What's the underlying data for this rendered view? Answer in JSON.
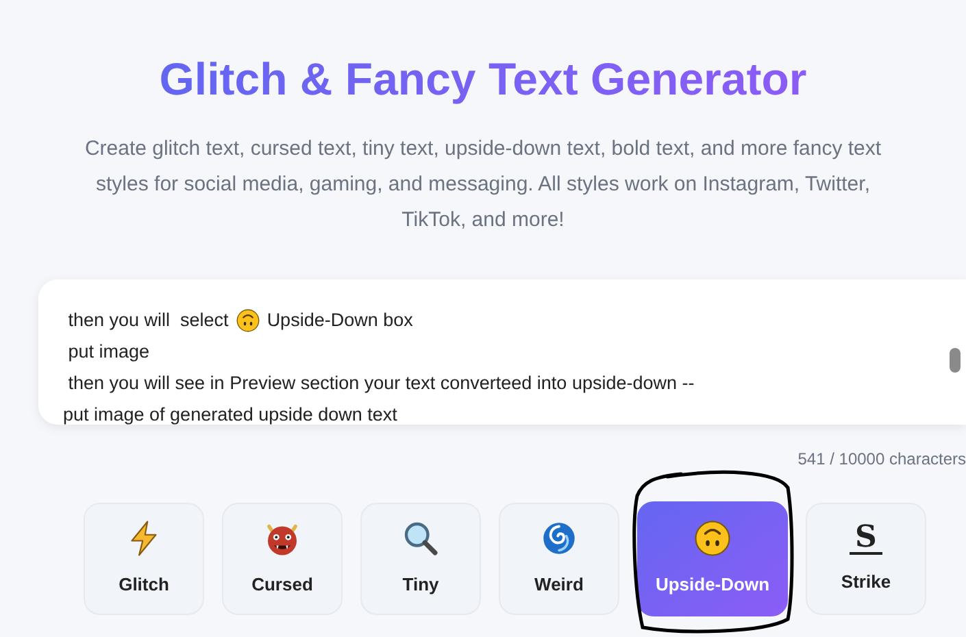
{
  "header": {
    "title": "Glitch & Fancy Text Generator",
    "description": "Create glitch text, cursed text, tiny text, upside-down text, bold text, and more fancy text styles for social media, gaming, and messaging. All styles work on Instagram, Twitter, TikTok, and more!"
  },
  "editor": {
    "lines": [
      {
        "parts": [
          {
            "kind": "text",
            "text": " then you will  select"
          },
          {
            "kind": "face"
          },
          {
            "kind": "text",
            "text": "Upside-Down box"
          }
        ]
      },
      {
        "parts": [
          {
            "kind": "text",
            "text": " put image"
          }
        ]
      },
      {
        "parts": [
          {
            "kind": "text",
            "text": " then you will see in Preview section your text converteed into upside-down --"
          }
        ]
      },
      {
        "parts": [
          {
            "kind": "text",
            "text": "put image of generated upside down text"
          }
        ]
      }
    ],
    "counter": "541 / 10000 characters"
  },
  "styles": [
    {
      "label": "Glitch",
      "kind": "bolt",
      "selected": false
    },
    {
      "label": "Cursed",
      "kind": "ogre",
      "selected": false
    },
    {
      "label": "Tiny",
      "kind": "magnifier",
      "selected": false
    },
    {
      "label": "Weird",
      "kind": "cyclone",
      "selected": false
    },
    {
      "label": "Upside-Down",
      "kind": "face",
      "selected": true,
      "circled": true
    },
    {
      "label": "Strike",
      "kind": "glyph",
      "glyph": "S",
      "selected": false
    }
  ]
}
